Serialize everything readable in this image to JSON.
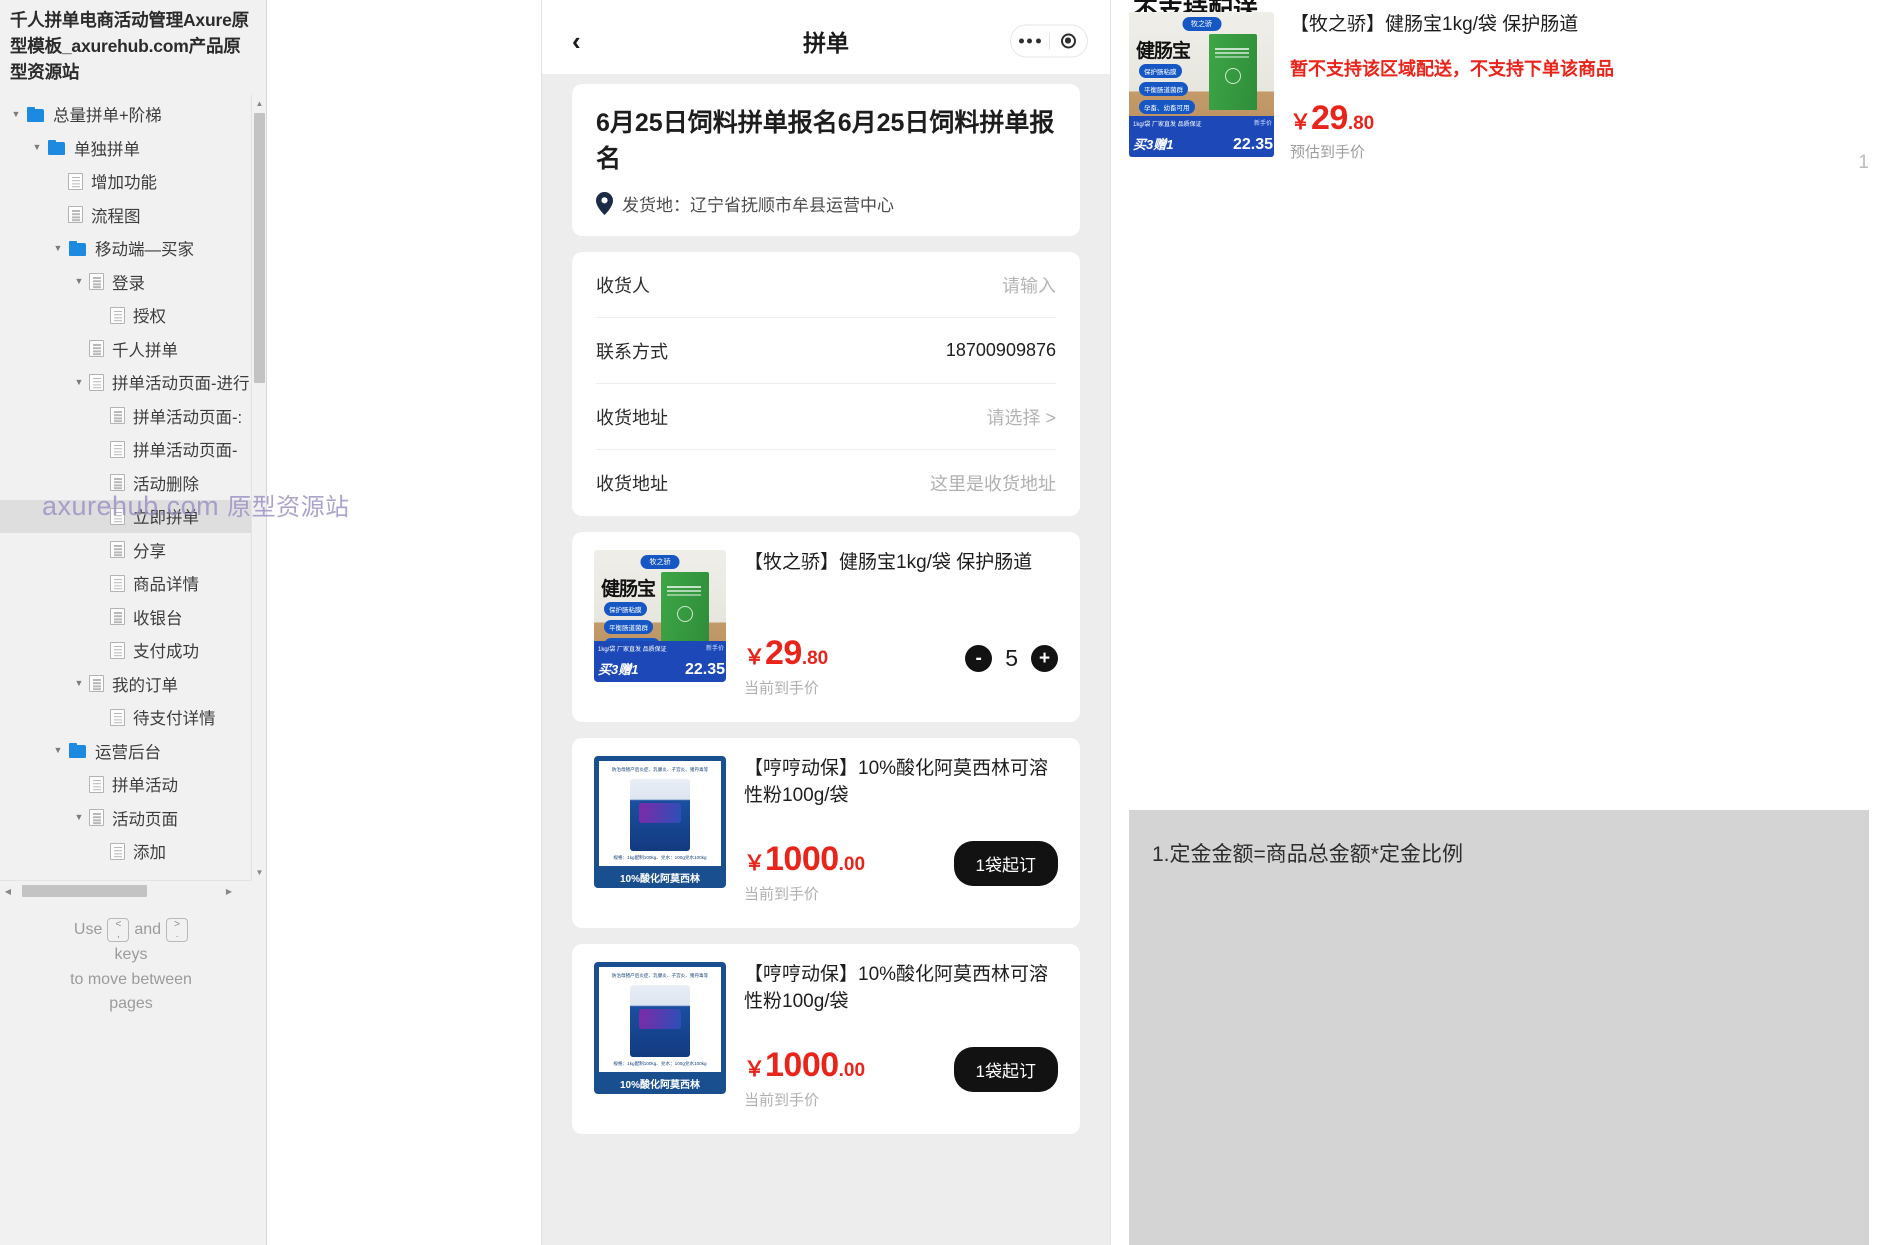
{
  "sidebar": {
    "title": "千人拼单电商活动管理Axure原型模板_axurehub.com产品原型资源站",
    "tree": [
      {
        "label": "总量拼单+阶梯",
        "depth": 0,
        "type": "folder",
        "twisty": "down",
        "selected": false
      },
      {
        "label": "单独拼单",
        "depth": 1,
        "type": "folder",
        "twisty": "down",
        "selected": false
      },
      {
        "label": "增加功能",
        "depth": 2,
        "type": "page",
        "twisty": "none",
        "selected": false
      },
      {
        "label": "流程图",
        "depth": 2,
        "type": "page",
        "twisty": "none",
        "selected": false
      },
      {
        "label": "移动端—买家",
        "depth": 2,
        "type": "folder",
        "twisty": "down",
        "selected": false
      },
      {
        "label": "登录",
        "depth": 3,
        "type": "page",
        "twisty": "down",
        "selected": false
      },
      {
        "label": "授权",
        "depth": 4,
        "type": "page",
        "twisty": "none",
        "selected": false
      },
      {
        "label": "千人拼单",
        "depth": 3,
        "type": "page",
        "twisty": "none",
        "selected": false
      },
      {
        "label": "拼单活动页面-进行",
        "depth": 3,
        "type": "page",
        "twisty": "down",
        "selected": false
      },
      {
        "label": "拼单活动页面-:",
        "depth": 4,
        "type": "page",
        "twisty": "none",
        "selected": false
      },
      {
        "label": "拼单活动页面-",
        "depth": 4,
        "type": "page",
        "twisty": "none",
        "selected": false
      },
      {
        "label": "活动删除",
        "depth": 4,
        "type": "page",
        "twisty": "none",
        "selected": false
      },
      {
        "label": "立即拼单",
        "depth": 4,
        "type": "page",
        "twisty": "none",
        "selected": true
      },
      {
        "label": "分享",
        "depth": 4,
        "type": "page",
        "twisty": "none",
        "selected": false
      },
      {
        "label": "商品详情",
        "depth": 4,
        "type": "page",
        "twisty": "none",
        "selected": false
      },
      {
        "label": "收银台",
        "depth": 4,
        "type": "page",
        "twisty": "none",
        "selected": false
      },
      {
        "label": "支付成功",
        "depth": 4,
        "type": "page",
        "twisty": "none",
        "selected": false
      },
      {
        "label": "我的订单",
        "depth": 3,
        "type": "page",
        "twisty": "down",
        "selected": false
      },
      {
        "label": "待支付详情",
        "depth": 4,
        "type": "page",
        "twisty": "none",
        "selected": false
      },
      {
        "label": "运营后台",
        "depth": 2,
        "type": "folder",
        "twisty": "down",
        "selected": false
      },
      {
        "label": "拼单活动",
        "depth": 3,
        "type": "page",
        "twisty": "none",
        "selected": false
      },
      {
        "label": "活动页面",
        "depth": 3,
        "type": "page",
        "twisty": "down",
        "selected": false
      },
      {
        "label": "添加",
        "depth": 4,
        "type": "page",
        "twisty": "none",
        "selected": false
      }
    ],
    "keyboard_hint": {
      "use": "Use",
      "key_prev_top": "<",
      "key_prev_bottom": ",",
      "and": "and",
      "key_next_top": ">",
      "key_next_bottom": ".",
      "keys": "keys",
      "line2": "to move between",
      "line3": "pages"
    }
  },
  "watermark": {
    "domain": "axurehub.com",
    "cjk": "原型资源站"
  },
  "phone": {
    "navbar": {
      "back": "‹",
      "title": "拼单"
    },
    "activity": {
      "title": "6月25日饲料拼单报名6月25日饲料拼单报名",
      "ship_from": "发货地：辽宁省抚顺市牟县运营中心"
    },
    "form": [
      {
        "label": "收货人",
        "value": "请输入",
        "style": "placeholder"
      },
      {
        "label": "联系方式",
        "value": "18700909876",
        "style": "value"
      },
      {
        "label": "收货地址",
        "value": "请选择 >",
        "style": "placeholder"
      },
      {
        "label": "收货地址",
        "value": "这里是收货地址",
        "style": "muted"
      }
    ],
    "products": [
      {
        "name": "【牧之骄】健肠宝1kg/袋  保护肠道",
        "price_yen": "￥",
        "price_int": "29",
        "price_dec": ".80",
        "price_note": "当前到手价",
        "control": "stepper",
        "qty": "5",
        "minus": "-",
        "plus": "+",
        "img": "a",
        "img_badge": "牧之骄",
        "img_bigword": "健肠宝",
        "img_pills": [
          "保护肠粘膜",
          "平衡肠道菌群",
          "孕畜、幼畜可用"
        ],
        "img_small": "1kg/袋   厂家直发  品质保证",
        "img_buy": "买3赠1",
        "img_np": "新手价",
        "img_pv": "22.35"
      },
      {
        "name": "【哼哼动保】10%酸化阿莫西林可溶性粉100g/袋",
        "price_yen": "￥",
        "price_int": "1000",
        "price_dec": ".00",
        "price_note": "当前到手价",
        "control": "minbuy",
        "minbuy_label": "1袋起订",
        "img": "b",
        "img_topline": "防治母猪产后炎症、乳腺炎、子宫炎、猪丹毒等",
        "img_botline": "规格：1kg配制100kg、兑水：100g兑水100kg",
        "img_bluebar": "10%酸化阿莫西林"
      },
      {
        "name": "【哼哼动保】10%酸化阿莫西林可溶性粉100g/袋",
        "price_yen": "￥",
        "price_int": "1000",
        "price_dec": ".00",
        "price_note": "当前到手价",
        "control": "minbuy",
        "minbuy_label": "1袋起订",
        "img": "b",
        "img_topline": "防治母猪产后炎症、乳腺炎、子宫炎、猪丹毒等",
        "img_botline": "规格：1kg配制100kg、兑水：100g兑水100kg",
        "img_bluebar": "10%酸化阿莫西林"
      }
    ]
  },
  "right_panel": {
    "title": "不支持配送",
    "product": {
      "name": "【牧之骄】健肠宝1kg/袋  保护肠道",
      "warning": "暂不支持该区域配送，不支持下单该商品",
      "price_yen": "￥",
      "price_int": "29",
      "price_dec": ".80",
      "price_note": "预估到手价",
      "qty_partial": "1",
      "img_badge": "牧之骄",
      "img_bigword": "健肠宝",
      "img_pills": [
        "保护肠粘膜",
        "平衡肠道菌群",
        "孕畜、幼畜可用"
      ],
      "img_small": "1kg/袋   厂家直发  品质保证",
      "img_buy": "买3赠1",
      "img_np": "新手价",
      "img_pv": "22.35"
    },
    "note": {
      "line1": "1.定金金额=商品总金额*定金比例"
    }
  },
  "colors": {
    "price_red": "#e8241b",
    "folder_blue": "#1c8ae0",
    "selected_row": "#dedede",
    "watermark": "#9b8fc4",
    "note_bg": "#d4d4d4"
  }
}
